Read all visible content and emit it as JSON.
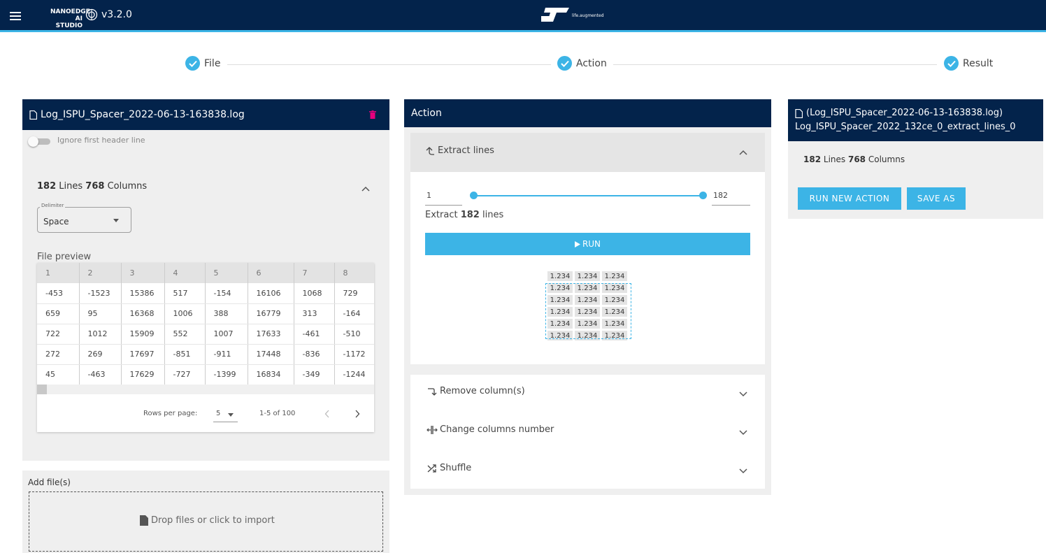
{
  "topbar": {
    "brand_line1": "NANOEDGE AI",
    "brand_line2": "STUDIO",
    "version": "v3.2.0",
    "tagline": "life.augmented"
  },
  "stepper": [
    {
      "label": "File"
    },
    {
      "label": "Action"
    },
    {
      "label": "Result"
    }
  ],
  "file_panel": {
    "filename": "Log_ISPU_Spacer_2022-06-13-163838.log",
    "ignore_header_label": "Ignore first header line",
    "ignore_header_on": false,
    "lines": "182",
    "lines_label": "Lines",
    "columns": "768",
    "columns_label": "Columns",
    "delimiter_label": "Delimiter",
    "delimiter_value": "Space",
    "preview_label": "File preview",
    "table": {
      "headers": [
        "1",
        "2",
        "3",
        "4",
        "5",
        "6",
        "7",
        "8"
      ],
      "rows": [
        [
          "-453",
          "-1523",
          "15386",
          "517",
          "-154",
          "16106",
          "1068",
          "729"
        ],
        [
          "659",
          "95",
          "16368",
          "1006",
          "388",
          "16779",
          "313",
          "-164"
        ],
        [
          "722",
          "1012",
          "15909",
          "552",
          "1007",
          "17633",
          "-461",
          "-510"
        ],
        [
          "272",
          "269",
          "17697",
          "-851",
          "-911",
          "17448",
          "-836",
          "-1172"
        ],
        [
          "45",
          "-463",
          "17629",
          "-727",
          "-1399",
          "16834",
          "-349",
          "-1244"
        ]
      ]
    },
    "pagination": {
      "rows_per_page_label": "Rows per page:",
      "rows_per_page": "5",
      "range": "1-5 of 100"
    }
  },
  "add_files": {
    "title": "Add file(s)",
    "drop_text": "Drop files or click to import"
  },
  "action_panel": {
    "title": "Action",
    "extract": {
      "title": "Extract lines",
      "from": "1",
      "to": "182",
      "summary_prefix": "Extract",
      "summary_count": "182",
      "summary_suffix": "lines",
      "run_label": "RUN",
      "matrix_value": "1.234"
    },
    "items": [
      {
        "label": "Remove column(s)"
      },
      {
        "label": "Change columns number"
      },
      {
        "label": "Shuffle"
      }
    ]
  },
  "result_panel": {
    "header_line1": "(Log_ISPU_Spacer_2022-06-13-163838.log)",
    "header_line2": "Log_ISPU_Spacer_2022_132ce_0_extract_lines_0",
    "lines": "182",
    "lines_label": "Lines",
    "columns": "768",
    "columns_label": "Columns",
    "run_new_label": "RUN NEW ACTION",
    "save_as_label": "SAVE AS"
  },
  "colors": {
    "navy": "#03234b",
    "accent": "#3cb4e6",
    "delete": "#e6007e"
  }
}
